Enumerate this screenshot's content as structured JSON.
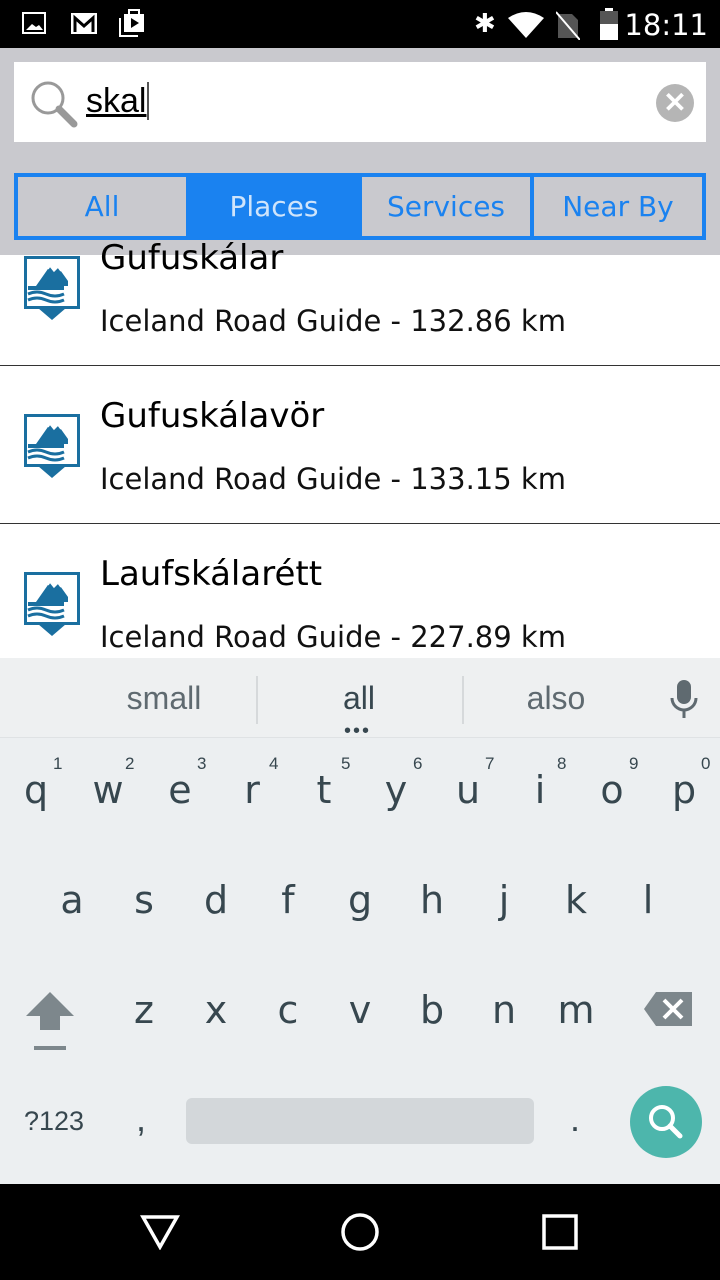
{
  "status_bar": {
    "time": "18:11",
    "icons": [
      "image-icon",
      "gmail-icon",
      "play-store-icon",
      "bluetooth-icon",
      "wifi-icon",
      "no-sim-icon",
      "battery-icon"
    ]
  },
  "search": {
    "query": "skal",
    "clear_icon": "clear-icon"
  },
  "tabs": [
    {
      "label": "All",
      "active": false
    },
    {
      "label": "Places",
      "active": true
    },
    {
      "label": "Services",
      "active": false
    },
    {
      "label": "Near By",
      "active": false
    }
  ],
  "results": [
    {
      "name": "Gufuskálar",
      "subtitle": "Iceland Road Guide - 132.86 km"
    },
    {
      "name": "Gufuskálavör",
      "subtitle": "Iceland Road Guide - 133.15 km"
    },
    {
      "name": "Laufskálarétt",
      "subtitle": "Iceland Road Guide - 227.89 km"
    }
  ],
  "keyboard": {
    "suggestions": [
      "small",
      "all",
      "also"
    ],
    "row1": [
      "q",
      "w",
      "e",
      "r",
      "t",
      "y",
      "u",
      "i",
      "o",
      "p"
    ],
    "hints": [
      "1",
      "2",
      "3",
      "4",
      "5",
      "6",
      "7",
      "8",
      "9",
      "0"
    ],
    "row2": [
      "a",
      "s",
      "d",
      "f",
      "g",
      "h",
      "j",
      "k",
      "l"
    ],
    "row3": [
      "z",
      "x",
      "c",
      "v",
      "b",
      "n",
      "m"
    ],
    "symbols": "?123",
    "comma": ",",
    "period": "."
  },
  "colors": {
    "accent": "#1a82f0",
    "icon_blue": "#1a6fa0",
    "search_key": "#4db6ac"
  }
}
